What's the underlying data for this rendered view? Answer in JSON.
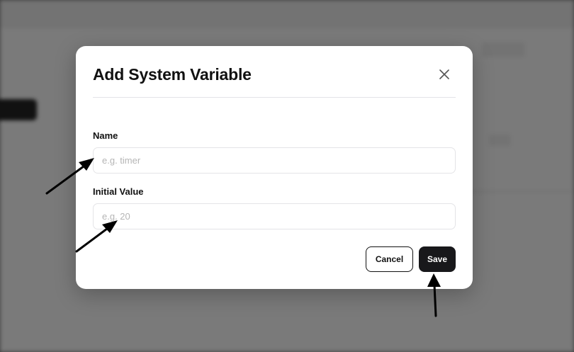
{
  "modal": {
    "title": "Add System Variable",
    "close_icon": "close-icon"
  },
  "form": {
    "name": {
      "label": "Name",
      "value": "",
      "placeholder": "e.g. timer"
    },
    "initial_value": {
      "label": "Initial Value",
      "value": "",
      "placeholder": "e.g. 20"
    }
  },
  "actions": {
    "cancel_label": "Cancel",
    "save_label": "Save"
  },
  "colors": {
    "primary": "#18181b",
    "border": "#e4e4e7",
    "overlay": "#000000"
  }
}
